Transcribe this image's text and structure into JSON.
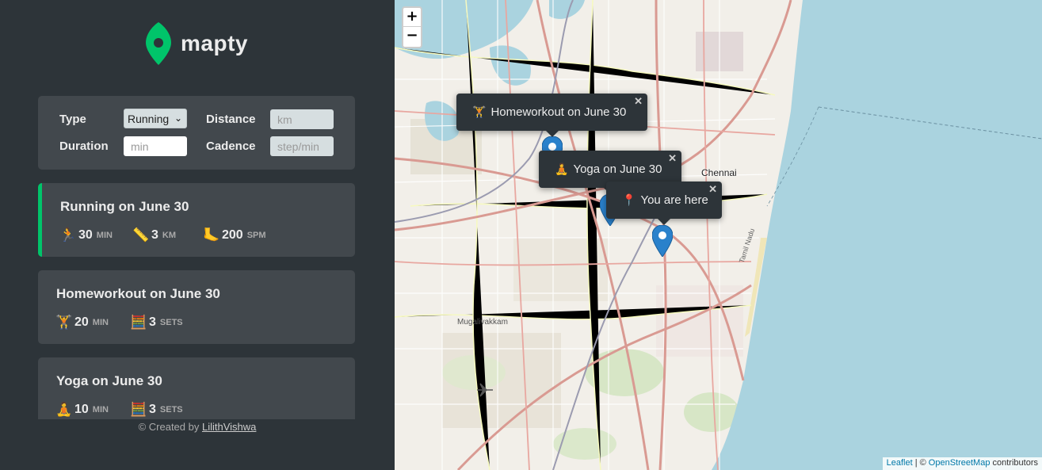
{
  "app": {
    "name": "mapty",
    "brand_color": "#00c46a"
  },
  "form": {
    "type_label": "Type",
    "type_value": "Running",
    "distance_label": "Distance",
    "distance_placeholder": "km",
    "duration_label": "Duration",
    "duration_placeholder": "min",
    "cadence_label": "Cadence",
    "cadence_placeholder": "step/min"
  },
  "workouts": [
    {
      "title": "Running on June 30",
      "accent": "#00c46a",
      "details": [
        {
          "icon": "running-icon",
          "value": "30",
          "unit": "min"
        },
        {
          "icon": "ruler-icon",
          "value": "3",
          "unit": "km"
        },
        {
          "icon": "foot-icon",
          "value": "200",
          "unit": "spm"
        }
      ]
    },
    {
      "title": "Homeworkout on June 30",
      "details": [
        {
          "icon": "weightlifting-icon",
          "value": "20",
          "unit": "min"
        },
        {
          "icon": "abacus-icon",
          "value": "3",
          "unit": "sets"
        }
      ]
    },
    {
      "title": "Yoga on June 30",
      "details": [
        {
          "icon": "yoga-icon",
          "value": "10",
          "unit": "min"
        },
        {
          "icon": "abacus-icon",
          "value": "3",
          "unit": "sets"
        }
      ]
    }
  ],
  "footer": {
    "prefix": "© Created by",
    "author": "LilithVishwa"
  },
  "map": {
    "zoom_in": "+",
    "zoom_out": "−",
    "popups": [
      {
        "text": "Homeworkout on June 30",
        "icon": "weightlifting-icon"
      },
      {
        "text": "Yoga on June 30",
        "icon": "yoga-icon"
      },
      {
        "text": "You are here",
        "icon": "pin-icon"
      }
    ],
    "close_glyph": "✕",
    "labels": {
      "city": "Chennai",
      "area": "Mugalivakkam",
      "road": "Tamil Nadu"
    },
    "attribution": {
      "leaflet": "Leaflet",
      "separator": "| ©",
      "osm": "OpenStreetMap",
      "suffix": "contributors"
    },
    "sea_color": "#aad3df"
  }
}
